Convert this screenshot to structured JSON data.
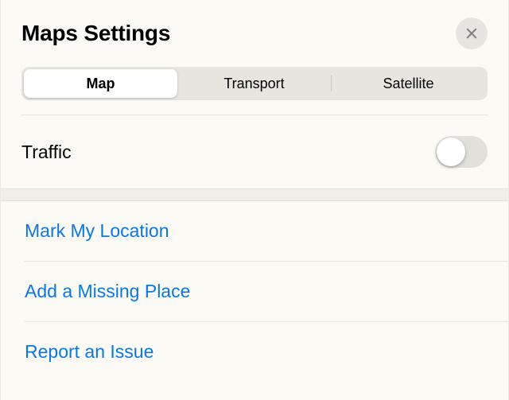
{
  "header": {
    "title": "Maps Settings"
  },
  "segmented": {
    "items": [
      "Map",
      "Transport",
      "Satellite"
    ],
    "active_index": 0
  },
  "traffic": {
    "label": "Traffic",
    "on": false
  },
  "actions": {
    "mark_location": "Mark My Location",
    "add_missing": "Add a Missing Place",
    "report_issue": "Report an Issue"
  }
}
